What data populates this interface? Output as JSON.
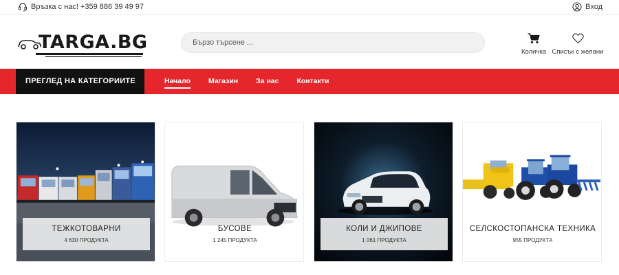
{
  "topbar": {
    "contact_label": "Връзка с нас! +359 886 39 49 97",
    "login_label": "Вход"
  },
  "header": {
    "logo_text": "TARGA.BG",
    "search_placeholder": "Бързо търсене ...",
    "cart_label": "Количка",
    "wishlist_label": "Списък с желани"
  },
  "nav": {
    "categories_button": "ПРЕГЛЕД НА КАТЕГОРИИТЕ",
    "links": [
      "Начало",
      "Магазин",
      "За нас",
      "Контакти"
    ],
    "active_index": 0,
    "accent_color": "#e5262d"
  },
  "categories": [
    {
      "title": "ТЕЖКОТОВАРНИ",
      "count": "4 630 ПРОДУКТА",
      "image": "trucks-at-night"
    },
    {
      "title": "БУСОВЕ",
      "count": "1 245 ПРОДУКТА",
      "image": "white-van"
    },
    {
      "title": "КОЛИ И ДЖИПОВЕ",
      "count": "1 061 ПРОДУКТА",
      "image": "white-suv"
    },
    {
      "title": "СЕЛСКОСТОПАНСКА ТЕХНИКА",
      "count": "955 ПРОДУКТА",
      "image": "tractors"
    }
  ]
}
